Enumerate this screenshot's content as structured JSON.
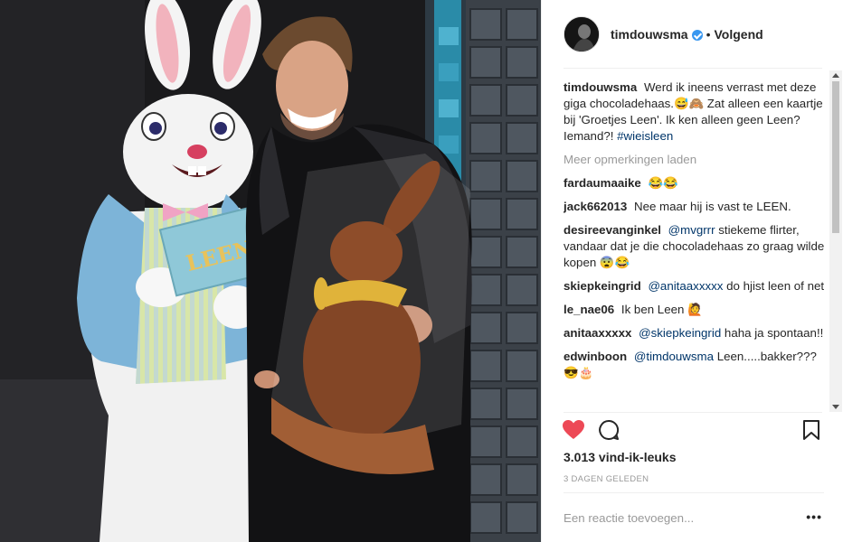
{
  "post": {
    "author": "timdouwsma",
    "follow_label": "Volgend",
    "separator": "•",
    "photo_sign_text": "LEEN"
  },
  "comments": {
    "caption": {
      "user": "timdouwsma",
      "text": "Werd ik ineens verrast met deze giga chocoladehaas.😅🙈 Zat alleen een kaartje bij 'Groetjes Leen'. Ik ken alleen geen Leen? Iemand?!",
      "hashtag": "#wieisleen"
    },
    "load_more": "Meer opmerkingen laden",
    "items": [
      {
        "user": "fardaumaaike",
        "mention": "",
        "text": "😂😂"
      },
      {
        "user": "jack662013",
        "mention": "",
        "text": "Nee maar hij is vast te LEEN."
      },
      {
        "user": "desireevanginkel",
        "mention": "@mvgrrr",
        "text": "stiekeme flirter, vandaar dat je die chocoladehaas zo graag wilde kopen 😨😂"
      },
      {
        "user": "skiepkeingrid",
        "mention": "@anitaaxxxxx",
        "text": "do hjist leen of net"
      },
      {
        "user": "le_nae06",
        "mention": "",
        "text": "Ik ben Leen 🙋"
      },
      {
        "user": "anitaaxxxxx",
        "mention": "@skiepkeingrid",
        "text": "haha ja spontaan!!"
      },
      {
        "user": "edwinboon",
        "mention": "@timdouwsma",
        "text": "Leen.....bakker??? 😎🎂"
      }
    ]
  },
  "actions": {
    "like_icon": "heart-icon",
    "comment_icon": "comment-icon",
    "save_icon": "bookmark-icon"
  },
  "likes_label": "3.013 vind-ik-leuks",
  "time_label": "3 DAGEN GELEDEN",
  "add_comment": {
    "placeholder": "Een reactie toevoegen...",
    "more_label": "•••"
  },
  "colors": {
    "like": "#ed4956",
    "link": "#003569",
    "verified": "#3897f0",
    "muted": "#999999"
  }
}
